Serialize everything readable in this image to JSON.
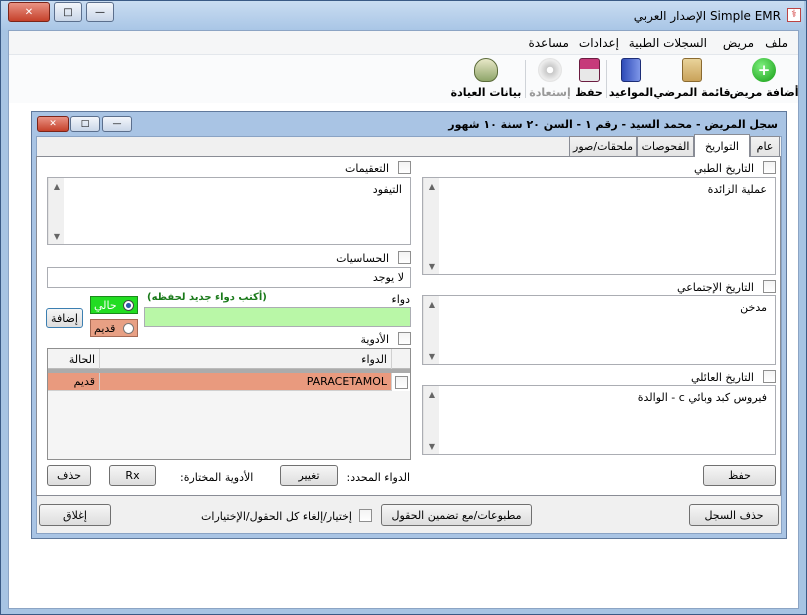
{
  "window": {
    "title": "Simple EMR الإصدار العربي",
    "icon_glyph": "⚕",
    "minimize": "—",
    "maximize": "□",
    "close": "✕"
  },
  "menu": [
    "ملف",
    "مريض",
    "السجلات الطبية",
    "إعدادات",
    "مساعدة"
  ],
  "toolbar": {
    "add_patient": "أضافة مريض",
    "patient_list": "قائمة المرضي",
    "appointments": "المواعيد",
    "save": "حفظ",
    "restore": "إستعادة",
    "clinic_data": "بيانات العيادة"
  },
  "record": {
    "title": "سجل المريض - محمد السيد - رقم ١ - السن ٢٠ سنة ١٠ شهور",
    "tabs": [
      "عام",
      "التواريخ",
      "الفحوصات",
      "ملحقات/صور"
    ],
    "medical_history": {
      "label": "التاريخ الطبي",
      "value": "عملية الزائدة"
    },
    "social_history": {
      "label": "التاريخ الإجتماعي",
      "value": "مدخن"
    },
    "family_history": {
      "label": "التاريخ العائلي",
      "value": "فيروس كبد وبائي c - الوالدة"
    },
    "complications": {
      "label": "التعقيمات",
      "value": "التيفود"
    },
    "allergies": {
      "label": "الحساسيات",
      "value": "لا يوجد"
    },
    "drug_label": "دواء",
    "drug_hint": "(أكتب دواء جديد لحفظه)",
    "drug_input": "",
    "current": "حالي",
    "old": "قديم",
    "add": "إضافة",
    "medications_label": "الأدوية",
    "grid": {
      "col_drug": "الدواء",
      "col_status": "الحالة",
      "rows": [
        {
          "drug": "PARACETAMOL",
          "status": "قديم"
        }
      ]
    },
    "selected_drug_label": "الدواء المحدد:",
    "change": "تغيير",
    "selected_meds_label": "الأدوية المختارة:",
    "rx": "Rx",
    "delete": "حذف",
    "save": "حفظ"
  },
  "footer": {
    "delete_record": "حذف السجل",
    "print": "مطبوعات/مع تضمين الحقول",
    "select_all": "إختيار/إلغاء كل الحقول/الإختيارات",
    "close": "إغلاق"
  },
  "colors": {
    "row_highlight": "#e99a7e",
    "radio_current_bg": "#22dd22",
    "radio_old_bg": "#e8a084",
    "drug_input_bg": "#b9f7a7",
    "hint_text": "#1a7a1a"
  }
}
